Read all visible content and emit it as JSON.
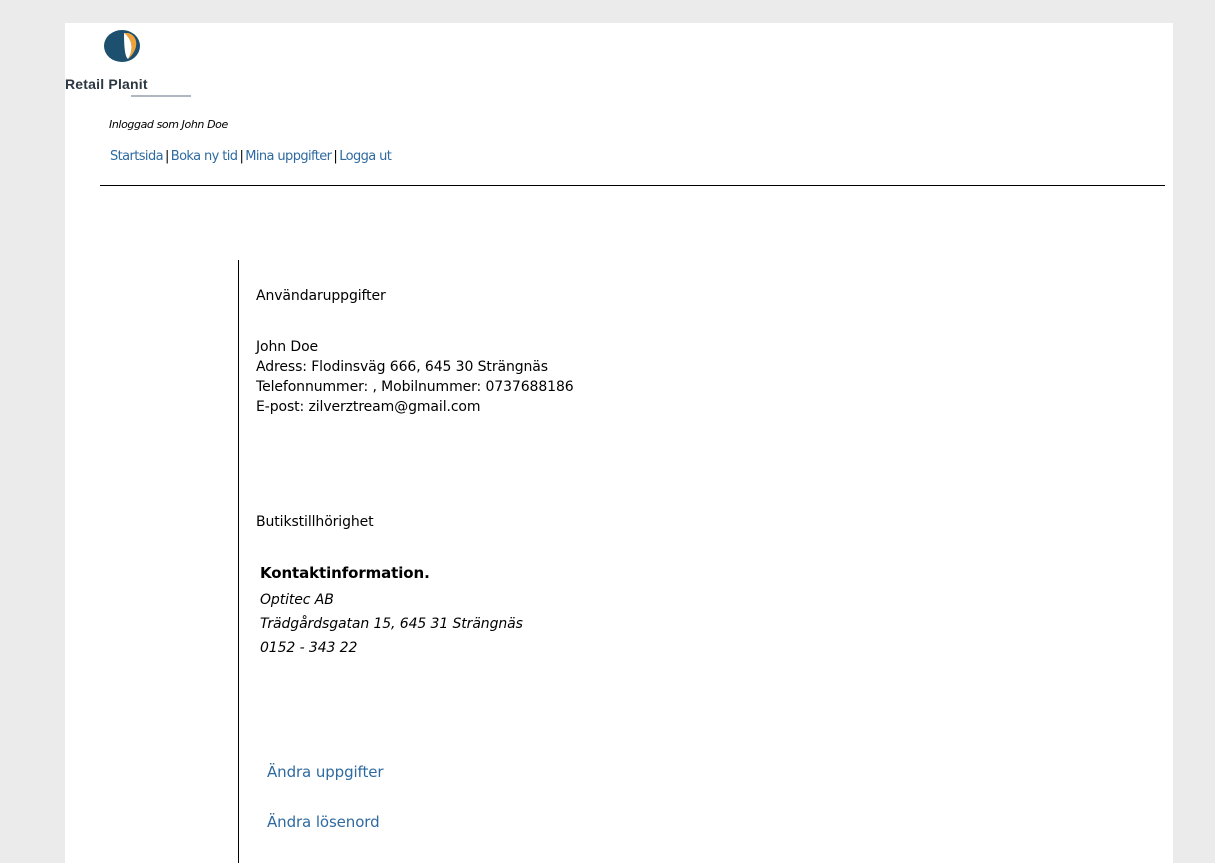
{
  "brand": {
    "name": "Retail Planit",
    "logo_colors": {
      "dark": "#1d4f6e",
      "light": "#ffffff",
      "accent": "#f0a23a"
    }
  },
  "header": {
    "logged_in_as": "Inloggad som John Doe"
  },
  "nav": {
    "items": [
      {
        "label": "Startsida"
      },
      {
        "label": "Boka ny tid"
      },
      {
        "label": "Mina uppgifter"
      },
      {
        "label": "Logga ut"
      }
    ],
    "separator": "|"
  },
  "user": {
    "section_title": "Användaruppgifter",
    "name": "John Doe",
    "address": "Adress: Flodinsväg 666, 645 30 Strängnäs",
    "phone": "Telefonnummer: , Mobilnummer: 0737688186",
    "email": "E-post: zilverztream@gmail.com"
  },
  "store": {
    "section_title": "Butikstillhörighet",
    "contact_heading": "Kontaktinformation.",
    "company": "Optitec AB",
    "address": "Trädgårdsgatan 15, 645 31 Strängnäs",
    "phone": "0152 - 343 22"
  },
  "actions": {
    "edit_details": "Ändra uppgifter",
    "change_password": "Ändra lösenord"
  },
  "colors": {
    "link": "#2e6aa0",
    "page_bg": "#ecebeb",
    "card_bg": "#ffffff"
  }
}
